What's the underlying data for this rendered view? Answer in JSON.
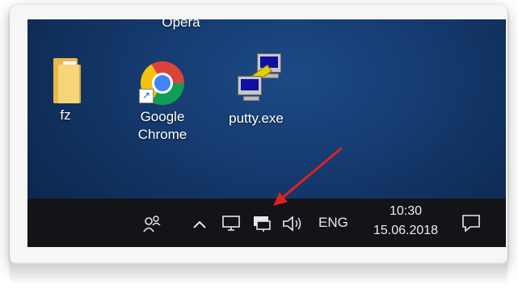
{
  "desktop": {
    "partial_label": "Opera",
    "icons": [
      {
        "label": "fz",
        "icon": "folder-icon"
      },
      {
        "label_line1": "Google",
        "label_line2": "Chrome",
        "icon": "chrome-icon"
      },
      {
        "label": "putty.exe",
        "icon": "putty-icon"
      }
    ]
  },
  "taskbar": {
    "people_icon": "people-icon",
    "chevron_icon": "chevron-up-icon",
    "language": "ENG",
    "time": "10:30",
    "date": "15.06.2018"
  },
  "annotation": {
    "arrow_color": "#e02020"
  },
  "colors": {
    "taskbar": "#121417",
    "desktop": "#163c72"
  }
}
